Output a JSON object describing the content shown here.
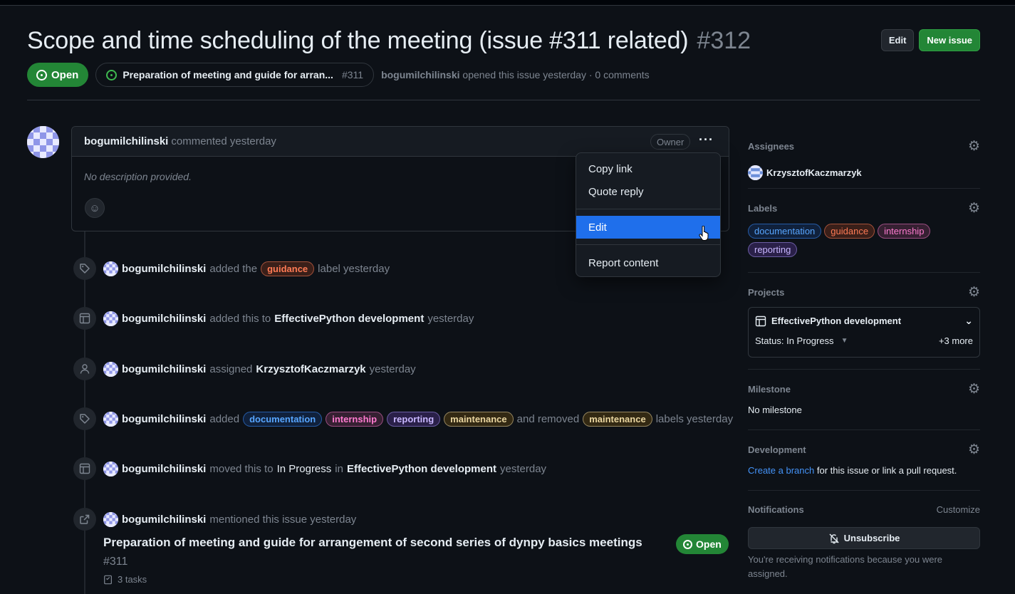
{
  "issue": {
    "title": "Scope and time scheduling of the meeting (issue #311 related)",
    "number": "#312",
    "state": "Open",
    "parent_title": "Preparation of meeting and guide for arran...",
    "parent_number": "#311",
    "author": "bogumilchilinski",
    "opened_text": "opened this issue yesterday · 0 comments"
  },
  "header_buttons": {
    "edit": "Edit",
    "new_issue": "New issue"
  },
  "comment": {
    "author": "bogumilchilinski",
    "meta": "commented yesterday",
    "badge": "Owner",
    "menu_glyph": "···",
    "body": "No description provided."
  },
  "menu": {
    "copy_link": "Copy link",
    "quote_reply": "Quote reply",
    "edit": "Edit",
    "report": "Report content"
  },
  "timeline": {
    "e1": {
      "user": "bogumilchilinski",
      "t1": "added the",
      "label": "guidance",
      "t2": "label yesterday"
    },
    "e2": {
      "user": "bogumilchilinski",
      "t1": "added this to",
      "project": "EffectivePython development",
      "t2": "yesterday"
    },
    "e3": {
      "user": "bogumilchilinski",
      "t1": "assigned",
      "assignee": "KrzysztofKaczmarzyk",
      "t2": "yesterday"
    },
    "e4": {
      "user": "bogumilchilinski",
      "t1": "added",
      "l1": "documentation",
      "l2": "internship",
      "l3": "reporting",
      "l4": "maintenance",
      "t2": "and removed",
      "l5": "maintenance",
      "t3": "labels yesterday"
    },
    "e5": {
      "user": "bogumilchilinski",
      "t1": "moved this to",
      "status": "In Progress",
      "t2": "in",
      "project": "EffectivePython development",
      "t3": "yesterday"
    },
    "e6": {
      "user": "bogumilchilinski",
      "t1": "mentioned this issue yesterday"
    }
  },
  "reference": {
    "title": "Preparation of meeting and guide for arrangement of second series of dynpy basics meetings",
    "number": "#311",
    "tasks": "3 tasks",
    "state": "Open"
  },
  "sidebar": {
    "assignees_heading": "Assignees",
    "assignee": "KrzysztofKaczmarzyk",
    "labels_heading": "Labels",
    "labels": [
      "documentation",
      "guidance",
      "internship",
      "reporting"
    ],
    "projects_heading": "Projects",
    "project_name": "EffectivePython development",
    "project_status": "Status: In Progress",
    "project_more": "+3 more",
    "milestone_heading": "Milestone",
    "milestone_value": "No milestone",
    "development_heading": "Development",
    "dev_link": "Create a branch",
    "dev_text": "for this issue or link a pull request.",
    "notifications_heading": "Notifications",
    "customize": "Customize",
    "unsubscribe": "Unsubscribe",
    "notif_reason": "You're receiving notifications because you were assigned."
  },
  "colors": {
    "accent_green": "#238636",
    "accent_blue": "#1f6feb",
    "background": "#0d1117"
  }
}
